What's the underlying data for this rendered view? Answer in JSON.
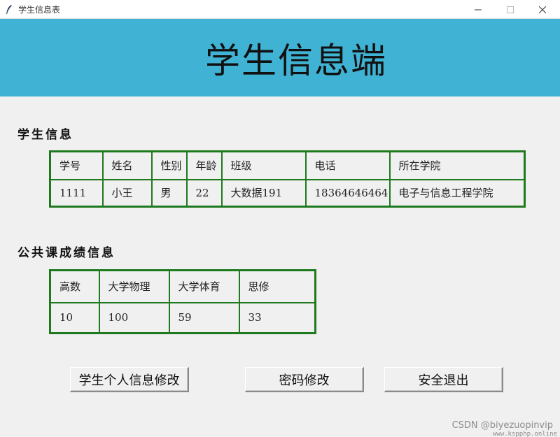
{
  "window": {
    "title": "学生信息表",
    "icon": "feather-icon"
  },
  "header": {
    "title": "学生信息端",
    "background": "#40b2d3"
  },
  "student_info": {
    "label": "学生信息",
    "headers": [
      "学号",
      "姓名",
      "性别",
      "年龄",
      "班级",
      "电话",
      "所在学院"
    ],
    "row": [
      "1111",
      "小王",
      "男",
      "22",
      "大数据191",
      "18364646464",
      "电子与信息工程学院"
    ]
  },
  "scores": {
    "label": "公共课成绩信息",
    "headers": [
      "高数",
      "大学物理",
      "大学体育",
      "思修"
    ],
    "row": [
      "10",
      "100",
      "59",
      "33"
    ]
  },
  "buttons": {
    "edit_info": "学生个人信息修改",
    "change_password": "密码修改",
    "logout": "安全退出"
  },
  "watermark": {
    "text": "CSDN @biyezuopinvip",
    "url_text": "www.kspphp.online"
  },
  "colors": {
    "table_border": "#1f7a1f"
  }
}
